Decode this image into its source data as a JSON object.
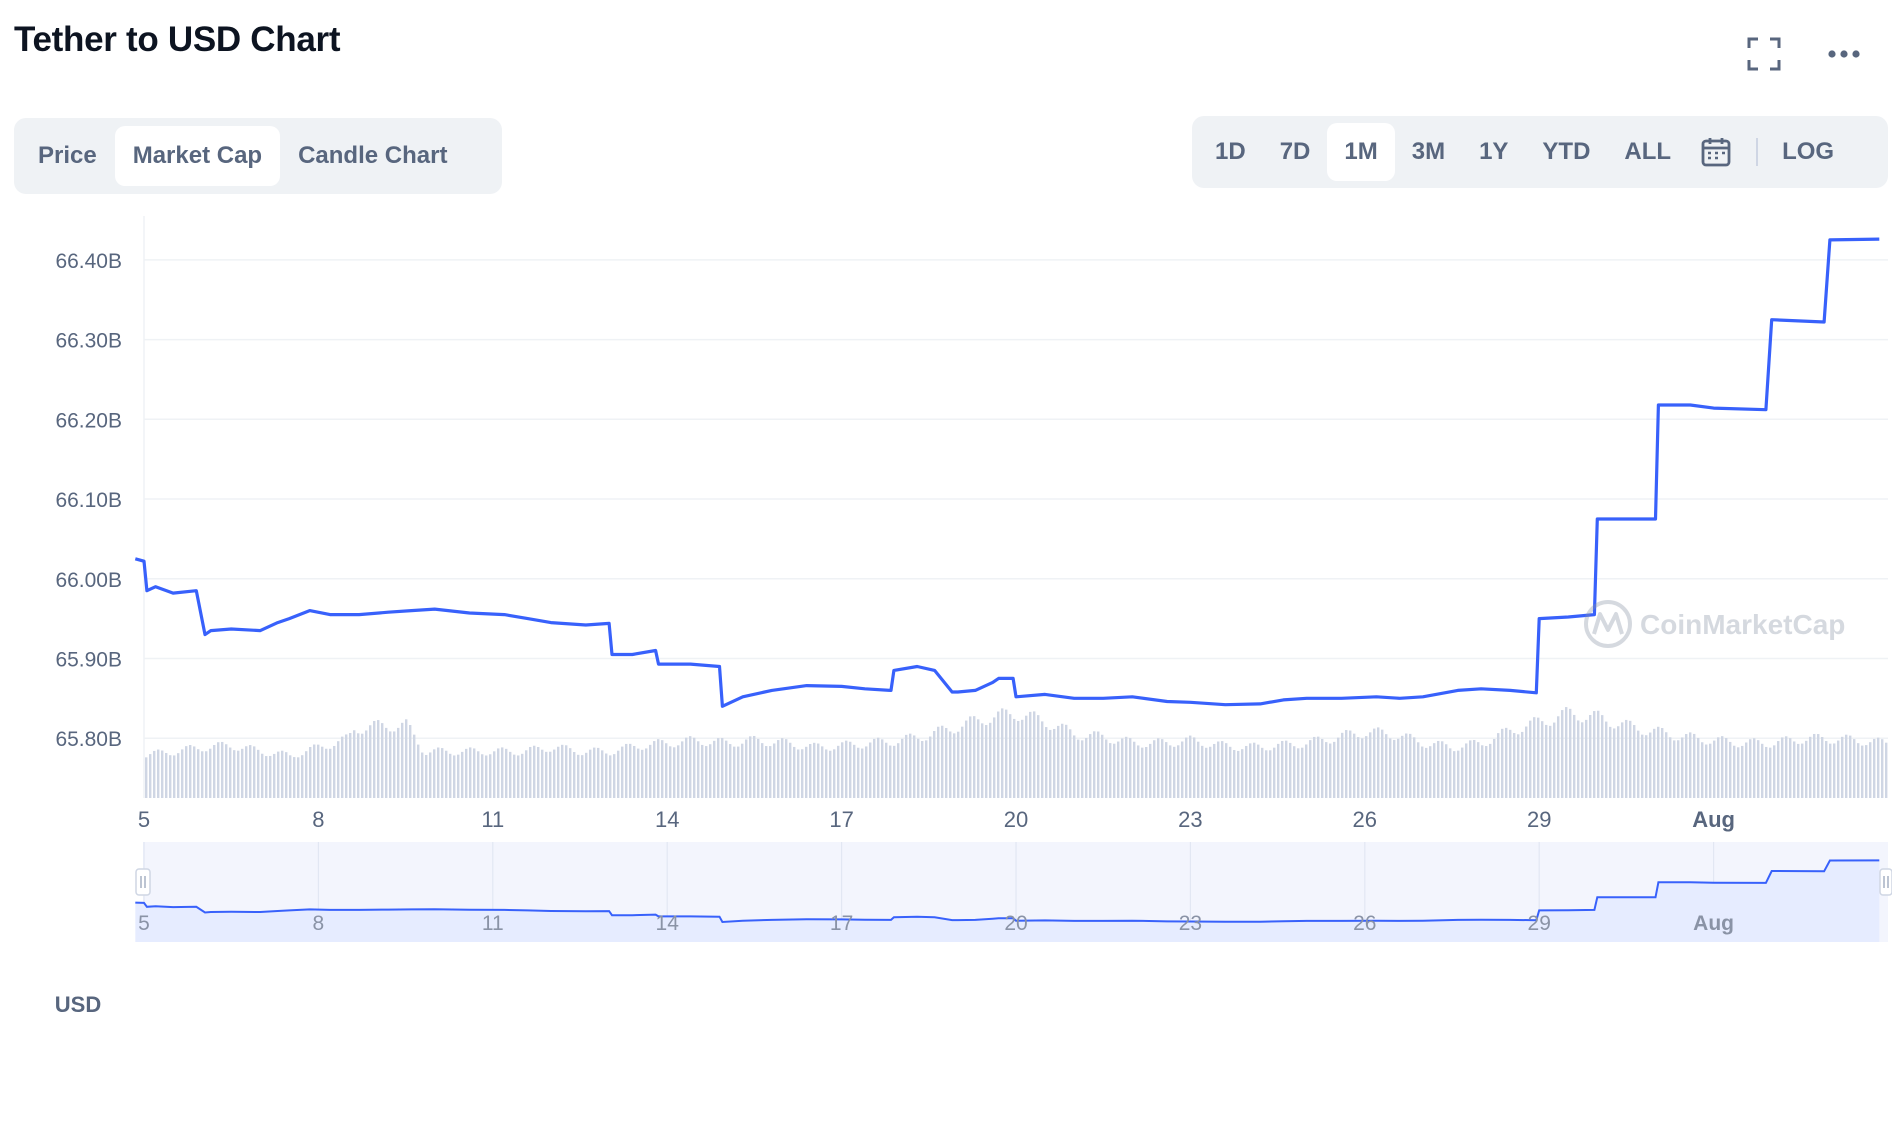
{
  "page": {
    "title": "Tether to USD Chart",
    "watermark": "CoinMarketCap"
  },
  "tabs": [
    {
      "label": "Price",
      "active": false
    },
    {
      "label": "Market Cap",
      "active": true
    },
    {
      "label": "Candle Chart",
      "active": false
    }
  ],
  "ranges": [
    {
      "label": "1D",
      "active": false
    },
    {
      "label": "7D",
      "active": false
    },
    {
      "label": "1M",
      "active": true
    },
    {
      "label": "3M",
      "active": false
    },
    {
      "label": "1Y",
      "active": false
    },
    {
      "label": "YTD",
      "active": false
    },
    {
      "label": "ALL",
      "active": false
    }
  ],
  "log_label": "LOG",
  "icons": [
    "fullscreen-icon",
    "more-icon",
    "calendar-icon",
    "coinmarketcap-logo-icon"
  ],
  "colors": {
    "line": "#3861fb",
    "volume": "#cfd6e4",
    "grid": "#eff2f5",
    "navigator_fill": "#e6ecff"
  },
  "chart_data": {
    "type": "line",
    "title": "",
    "ylabel": "USD",
    "ylim": [
      65.725,
      66.45
    ],
    "xlim": [
      5,
      35
    ],
    "y_ticks": [
      65.8,
      65.9,
      66.0,
      66.1,
      66.2,
      66.3,
      66.4
    ],
    "y_tick_labels": [
      "65.80B",
      "65.90B",
      "66.00B",
      "66.10B",
      "66.20B",
      "66.30B",
      "66.40B"
    ],
    "x_ticks": [
      5,
      8,
      11,
      14,
      17,
      20,
      23,
      26,
      29,
      32
    ],
    "x_tick_labels": [
      "5",
      "8",
      "11",
      "14",
      "17",
      "20",
      "23",
      "26",
      "29",
      "Aug"
    ],
    "grid": true,
    "series": [
      {
        "unit": "B USD",
        "x": [
          4.85,
          5.0,
          5.05,
          5.2,
          5.5,
          5.9,
          6.05,
          6.15,
          6.5,
          7.0,
          7.3,
          7.5,
          7.85,
          8.2,
          8.7,
          9.2,
          9.6,
          10.0,
          10.6,
          11.2,
          11.6,
          12.0,
          12.6,
          13.0,
          13.05,
          13.4,
          13.8,
          13.85,
          14.4,
          14.9,
          14.95,
          15.3,
          15.8,
          16.4,
          17.0,
          17.4,
          17.85,
          17.9,
          18.3,
          18.6,
          18.9,
          19.0,
          19.3,
          19.6,
          19.7,
          19.95,
          20.0,
          20.5,
          21.0,
          21.5,
          22.0,
          22.6,
          23.0,
          23.6,
          24.2,
          24.6,
          25.0,
          25.6,
          26.2,
          26.6,
          27.0,
          27.6,
          28.0,
          28.5,
          28.95,
          29.0,
          29.5,
          29.95,
          30.0,
          30.6,
          31.0,
          31.05,
          31.6,
          32.0,
          32.9,
          33.0,
          33.9,
          34.0,
          34.85
        ],
        "y": [
          66.025,
          66.022,
          65.985,
          65.99,
          65.982,
          65.985,
          65.93,
          65.935,
          65.937,
          65.935,
          65.945,
          65.95,
          65.96,
          65.955,
          65.955,
          65.958,
          65.96,
          65.962,
          65.957,
          65.955,
          65.95,
          65.945,
          65.942,
          65.944,
          65.905,
          65.905,
          65.91,
          65.893,
          65.893,
          65.89,
          65.84,
          65.852,
          65.86,
          65.866,
          65.865,
          65.862,
          65.86,
          65.885,
          65.89,
          65.885,
          65.858,
          65.858,
          65.86,
          65.87,
          65.875,
          65.875,
          65.852,
          65.855,
          65.85,
          65.85,
          65.852,
          65.846,
          65.845,
          65.842,
          65.843,
          65.848,
          65.85,
          65.85,
          65.852,
          65.85,
          65.852,
          65.86,
          65.862,
          65.86,
          65.857,
          65.95,
          65.952,
          65.955,
          66.075,
          66.075,
          66.075,
          66.218,
          66.218,
          66.214,
          66.212,
          66.325,
          66.322,
          66.425,
          66.426
        ]
      }
    ],
    "volume": {
      "x": [
        4.9,
        5.5,
        6.0,
        6.5,
        7.0,
        7.5,
        8.0,
        8.5,
        8.6,
        9.0,
        9.5,
        9.8,
        10.0,
        10.5,
        11.0,
        11.5,
        12.0,
        12.5,
        13.0,
        13.5,
        14.0,
        14.5,
        15.0,
        15.5,
        16.0,
        16.5,
        17.0,
        17.5,
        18.0,
        18.5,
        19.0,
        19.5,
        20.0,
        20.5,
        21.0,
        21.5,
        22.0,
        22.5,
        23.0,
        23.5,
        24.0,
        24.5,
        25.0,
        25.5,
        26.0,
        26.5,
        27.0,
        27.5,
        28.0,
        28.5,
        29.0,
        29.5,
        30.0,
        30.5,
        31.0,
        31.5,
        32.0,
        32.5,
        33.0,
        33.5,
        34.0,
        34.5,
        34.9
      ],
      "level": [
        0.5,
        0.55,
        0.6,
        0.62,
        0.55,
        0.5,
        0.6,
        0.7,
        0.82,
        0.85,
        0.86,
        0.55,
        0.55,
        0.55,
        0.55,
        0.55,
        0.6,
        0.55,
        0.55,
        0.62,
        0.65,
        0.68,
        0.65,
        0.68,
        0.65,
        0.6,
        0.62,
        0.65,
        0.68,
        0.75,
        0.85,
        0.95,
        1.0,
        0.9,
        0.75,
        0.72,
        0.65,
        0.65,
        0.68,
        0.62,
        0.6,
        0.62,
        0.65,
        0.72,
        0.78,
        0.75,
        0.65,
        0.6,
        0.65,
        0.8,
        0.9,
        1.0,
        0.95,
        0.85,
        0.78,
        0.72,
        0.68,
        0.65,
        0.65,
        0.7,
        0.7,
        0.68,
        0.65
      ]
    },
    "navigator": {
      "x_ticks": [
        5,
        8,
        11,
        14,
        17,
        20,
        23,
        26,
        29,
        32
      ],
      "x_tick_labels": [
        "5",
        "8",
        "11",
        "14",
        "17",
        "20",
        "23",
        "26",
        "29",
        "Aug"
      ]
    }
  }
}
